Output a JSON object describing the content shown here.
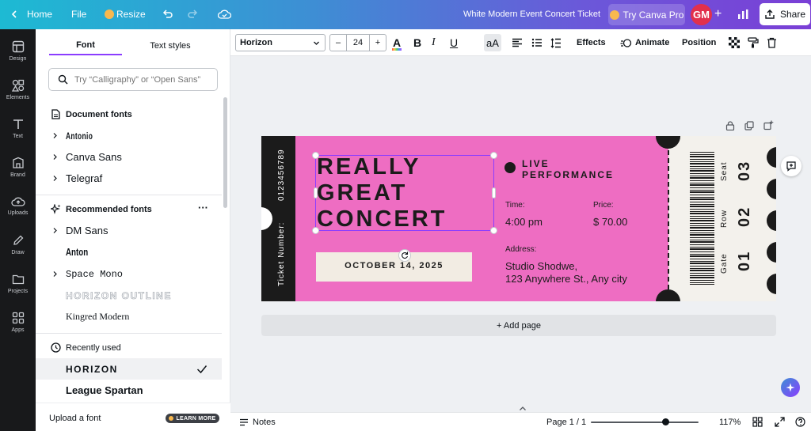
{
  "topbar": {
    "home": "Home",
    "file": "File",
    "resize": "Resize",
    "doc_title": "White Modern Event Concert Ticket",
    "try_pro": "Try Canva Pro",
    "avatar_initials": "GM",
    "share": "Share"
  },
  "rail": [
    {
      "label": "Design",
      "icon": "design-icon"
    },
    {
      "label": "Elements",
      "icon": "elements-icon"
    },
    {
      "label": "Text",
      "icon": "text-icon"
    },
    {
      "label": "Brand",
      "icon": "brand-icon"
    },
    {
      "label": "Uploads",
      "icon": "uploads-icon"
    },
    {
      "label": "Draw",
      "icon": "draw-icon"
    },
    {
      "label": "Projects",
      "icon": "projects-icon"
    },
    {
      "label": "Apps",
      "icon": "apps-icon"
    }
  ],
  "panel": {
    "tabs": [
      "Font",
      "Text styles"
    ],
    "search_placeholder": "Try “Calligraphy” or “Open Sans”",
    "document_fonts_title": "Document fonts",
    "document_fonts": [
      "Antonio",
      "Canva Sans",
      "Telegraf"
    ],
    "recommended_title": "Recommended fonts",
    "recommended_fonts": [
      "DM Sans",
      "Anton",
      "Space Mono",
      "Horizon Outline",
      "Kingred Modern"
    ],
    "recently_used_title": "Recently used",
    "recent_fonts": [
      "Horizon",
      "League Spartan"
    ],
    "upload_font": "Upload a font",
    "learn_more": "LEARN MORE"
  },
  "toolbar": {
    "font_name": "Horizon",
    "font_size": "24",
    "minus": "–",
    "plus": "+",
    "effects": "Effects",
    "animate": "Animate",
    "position": "Position"
  },
  "ticket": {
    "serial": "0123456789",
    "ticket_number_label": "Ticket Number:",
    "headline": [
      "REALLY",
      "GREAT",
      "CONCERT"
    ],
    "date": "OCTOBER 14, 2025",
    "live_performance": [
      "LIVE",
      "PERFORMANCE"
    ],
    "time_label": "Time:",
    "time_value": "4:00 pm",
    "price_label": "Price:",
    "price_value": "$ 70.00",
    "address_label": "Address:",
    "address_lines": [
      "Studio Shodwe,",
      "123 Anywhere St., Any city"
    ],
    "stub": [
      {
        "label": "Seat",
        "value": "03"
      },
      {
        "label": "Row",
        "value": "02"
      },
      {
        "label": "Gate",
        "value": "01"
      }
    ]
  },
  "add_page": "+ Add page",
  "bottom": {
    "notes": "Notes",
    "page_indicator": "Page 1 / 1",
    "zoom": "117%"
  },
  "colors": {
    "ticket_pink": "#ee6dc2",
    "ticket_dark": "#1b1b1b",
    "stub_bg": "#f3f1ec",
    "date_box": "#f2ece3",
    "selection": "#8b3dff"
  }
}
